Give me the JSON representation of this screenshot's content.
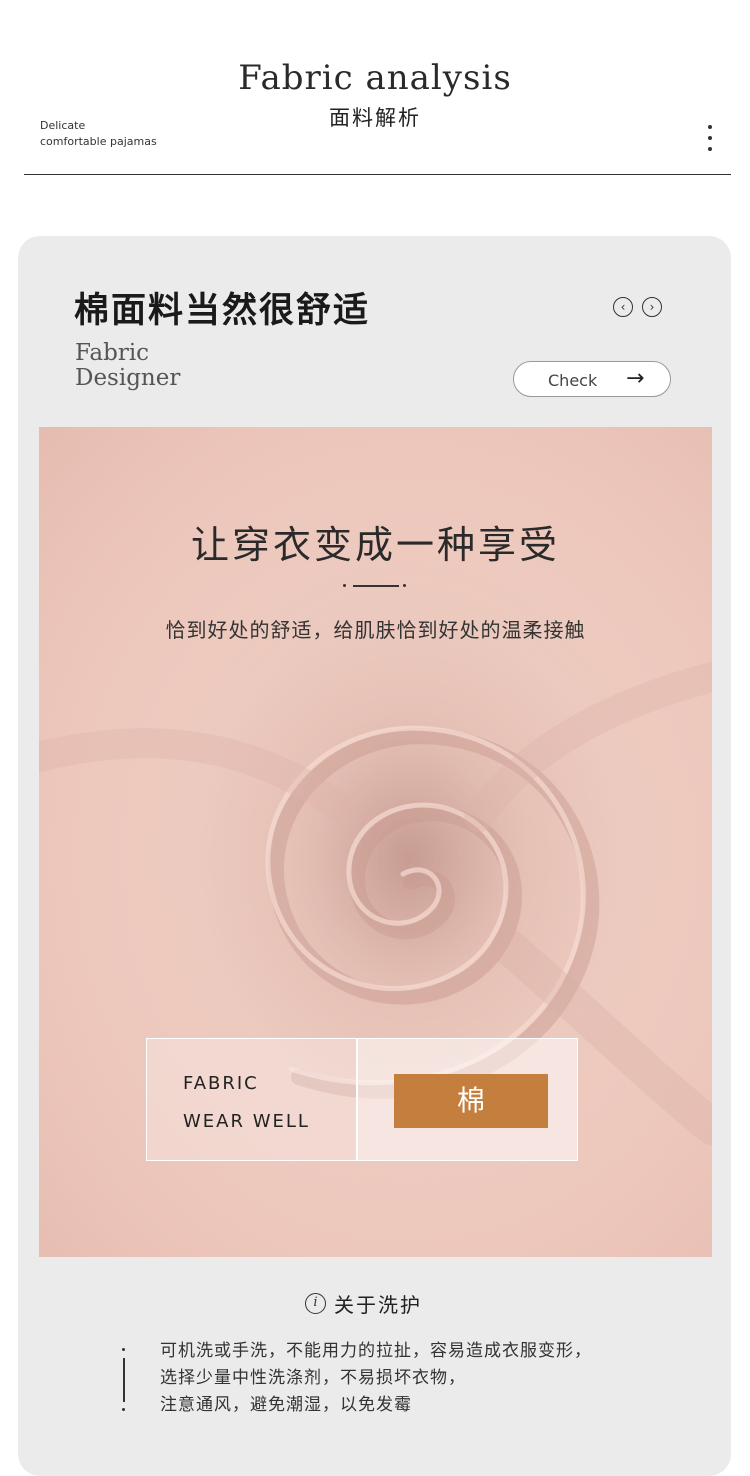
{
  "header": {
    "title": "Fabric analysis",
    "subtitle": "面料解析",
    "tagline_line1": "Delicate",
    "tagline_line2": "comfortable pajamas"
  },
  "card": {
    "title": "棉面料当然很舒适",
    "designer_line1": "Fabric",
    "designer_line2": "Designer",
    "check_label": "Check",
    "prev_icon": "‹",
    "next_icon": "›",
    "check_arrow": "→"
  },
  "fabric": {
    "headline": "让穿衣变成一种享受",
    "description": "恰到好处的舒适，给肌肤恰到好处的温柔接触",
    "info_line1": "FABRIC",
    "info_line2": "WEAR WELL",
    "material": "棉",
    "badge_color": "#c47f3f"
  },
  "care": {
    "icon_glyph": "i",
    "title": "关于洗护",
    "lines": [
      "可机洗或手洗，不能用力的拉扯，容易造成衣服变形，",
      "选择少量中性洗涤剂，不易损坏衣物，",
      "注意通风，避免潮湿，以免发霉"
    ]
  }
}
